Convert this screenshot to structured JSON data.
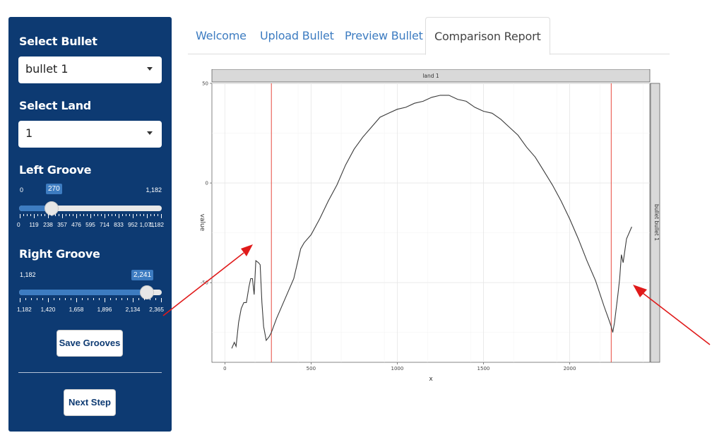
{
  "sidebar": {
    "select_bullet": {
      "label": "Select Bullet",
      "value": "bullet 1"
    },
    "select_land": {
      "label": "Select Land",
      "value": "1"
    },
    "left_groove": {
      "label": "Left Groove",
      "min": "0",
      "max": "1,182",
      "value": "270",
      "value_num": 270,
      "min_num": 0,
      "max_num": 1182,
      "ticks": [
        "0",
        "119",
        "238",
        "357",
        "476",
        "595",
        "714",
        "833",
        "952",
        "1,071",
        "1,182"
      ]
    },
    "right_groove": {
      "label": "Right Groove",
      "min": "1,182",
      "max": "2,365",
      "value": "2,241",
      "value_num": 2241,
      "min_num": 1182,
      "max_num": 2365,
      "ticks": [
        "1,182",
        "1,420",
        "1,658",
        "1,896",
        "2,134",
        "2,365"
      ]
    },
    "save_grooves": "Save Grooves",
    "next_step": "Next Step"
  },
  "tabs": [
    {
      "label": "Welcome",
      "active": false
    },
    {
      "label": "Upload Bullet",
      "active": false
    },
    {
      "label": "Preview Bullet",
      "active": false
    },
    {
      "label": "Comparison Report",
      "active": true
    }
  ],
  "plot": {
    "strip_top": "land 1",
    "strip_right": "bullet bullet 1",
    "xlabel": "x",
    "ylabel": "value"
  },
  "colors": {
    "sidebar_bg": "#0d3a72",
    "accent": "#3d7cc1",
    "groove_line": "#e8493f",
    "arrow": "#e01a1a"
  },
  "chart_data": {
    "type": "line",
    "title": "",
    "xlabel": "x",
    "ylabel": "value",
    "xlim": [
      -75,
      2465
    ],
    "ylim": [
      -90,
      50
    ],
    "xticks": [
      0,
      500,
      1000,
      1500,
      2000
    ],
    "yticks": [
      -50,
      0,
      50
    ],
    "grid": true,
    "facet_top": "land 1",
    "facet_right": "bullet bullet 1",
    "vlines": [
      270,
      2241
    ],
    "series": [
      {
        "points": [
          [
            40,
            -83
          ],
          [
            55,
            -80
          ],
          [
            65,
            -82
          ],
          [
            80,
            -70
          ],
          [
            95,
            -63
          ],
          [
            110,
            -60
          ],
          [
            125,
            -60
          ],
          [
            140,
            -52
          ],
          [
            150,
            -48
          ],
          [
            160,
            -48
          ],
          [
            170,
            -56
          ],
          [
            180,
            -39
          ],
          [
            195,
            -40
          ],
          [
            205,
            -41
          ],
          [
            215,
            -60
          ],
          [
            225,
            -72
          ],
          [
            240,
            -79
          ],
          [
            258,
            -77
          ],
          [
            270,
            -75
          ],
          [
            300,
            -68
          ],
          [
            350,
            -58
          ],
          [
            400,
            -48
          ],
          [
            440,
            -33
          ],
          [
            460,
            -30
          ],
          [
            500,
            -26
          ],
          [
            550,
            -18
          ],
          [
            600,
            -9
          ],
          [
            650,
            -1
          ],
          [
            700,
            9
          ],
          [
            750,
            17
          ],
          [
            800,
            23
          ],
          [
            850,
            28
          ],
          [
            900,
            33
          ],
          [
            950,
            35
          ],
          [
            1000,
            37
          ],
          [
            1050,
            38
          ],
          [
            1100,
            40
          ],
          [
            1150,
            41
          ],
          [
            1200,
            43
          ],
          [
            1250,
            44
          ],
          [
            1300,
            44
          ],
          [
            1350,
            42
          ],
          [
            1400,
            41
          ],
          [
            1450,
            38
          ],
          [
            1500,
            36
          ],
          [
            1550,
            35
          ],
          [
            1600,
            32
          ],
          [
            1650,
            28
          ],
          [
            1700,
            24
          ],
          [
            1750,
            18
          ],
          [
            1800,
            13
          ],
          [
            1850,
            6
          ],
          [
            1900,
            -1
          ],
          [
            1950,
            -9
          ],
          [
            2000,
            -18
          ],
          [
            2050,
            -28
          ],
          [
            2100,
            -39
          ],
          [
            2150,
            -49
          ],
          [
            2200,
            -62
          ],
          [
            2225,
            -68
          ],
          [
            2241,
            -72
          ],
          [
            2250,
            -75
          ],
          [
            2260,
            -70
          ],
          [
            2270,
            -63
          ],
          [
            2280,
            -56
          ],
          [
            2290,
            -48
          ],
          [
            2300,
            -36
          ],
          [
            2310,
            -40
          ],
          [
            2320,
            -34
          ],
          [
            2330,
            -28
          ],
          [
            2345,
            -25
          ],
          [
            2360,
            -22
          ]
        ]
      }
    ]
  }
}
